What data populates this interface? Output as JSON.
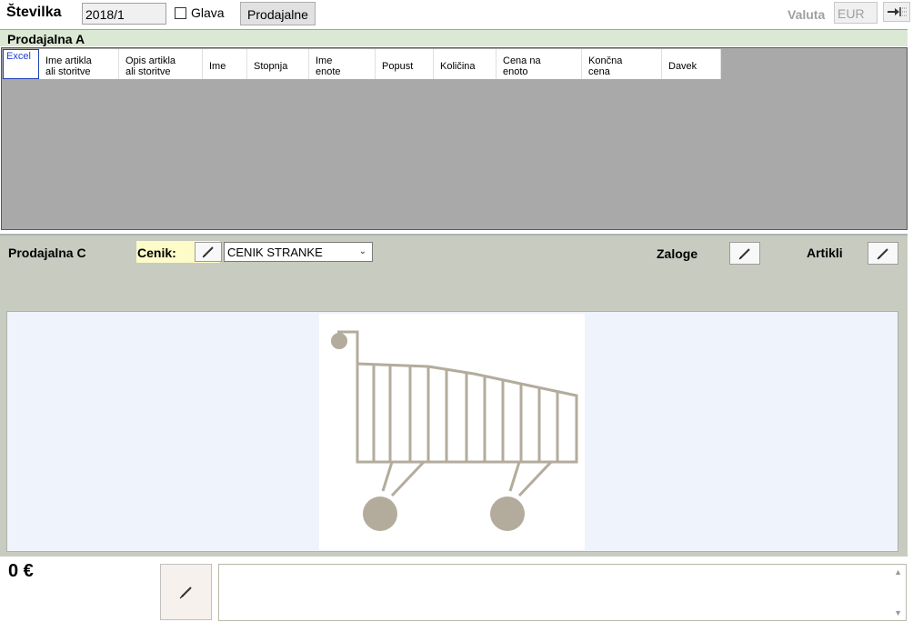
{
  "top": {
    "stevilka_label": "Številka",
    "stevilka_value": "2018/1",
    "glava_label": "Glava",
    "prodajalne_button": "Prodajalne",
    "valuta_label": "Valuta",
    "valuta_value": "EUR"
  },
  "section_a": {
    "title": "Prodajalna A",
    "columns": [
      "Excel",
      "Ime artikla\nali storitve",
      "Opis artikla\nali storitve",
      "Ime",
      "Stopnja",
      "Ime\nenote",
      "Popust",
      "Količina",
      "Cena na\nenoto",
      "Končna\ncena",
      "Davek"
    ]
  },
  "section_c": {
    "title": "Prodajalna C",
    "cenik_label": "Cenik:",
    "cenik_selected": "CENIK STRANKE",
    "zaloge_label": "Zaloge",
    "artikli_label": "Artikli"
  },
  "bottom": {
    "total": "0 €"
  },
  "colors": {
    "section_header_bg": "#dbe8d3",
    "grid_bg": "#a9a9a9",
    "panel_bg": "#c8cbbf",
    "cart_color": "#b3ac9c",
    "cenik_highlight": "#fdfbc8"
  }
}
